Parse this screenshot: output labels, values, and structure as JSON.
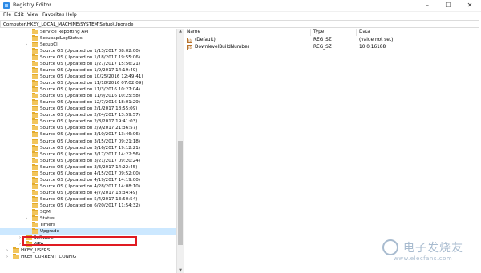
{
  "window": {
    "title": "Registry Editor"
  },
  "menu": [
    "File",
    "Edit",
    "View",
    "Favorites",
    "Help"
  ],
  "address": "Computer\\HKEY_LOCAL_MACHINE\\SYSTEM\\Setup\\Upgrade",
  "tree": [
    {
      "label": "Service Reporting API",
      "indent": 1
    },
    {
      "label": "SetupapiLogStatus",
      "indent": 1
    },
    {
      "label": "SetupCl",
      "indent": 1,
      "expander": "›"
    },
    {
      "label": "Source OS (Updated on 1/13/2017 08:02:00)",
      "indent": 1
    },
    {
      "label": "Source OS (Updated on 1/18/2017 19:55:06)",
      "indent": 1
    },
    {
      "label": "Source OS (Updated on 1/27/2017 15:56:21)",
      "indent": 1
    },
    {
      "label": "Source OS (Updated on 1/9/2017 14:19:49)",
      "indent": 1
    },
    {
      "label": "Source OS (Updated on 10/25/2016 12:49:41)",
      "indent": 1
    },
    {
      "label": "Source OS (Updated on 11/18/2016 07:02:09)",
      "indent": 1
    },
    {
      "label": "Source OS (Updated on 11/3/2016 10:27:04)",
      "indent": 1
    },
    {
      "label": "Source OS (Updated on 11/9/2016 10:25:58)",
      "indent": 1
    },
    {
      "label": "Source OS (Updated on 12/7/2016 18:01:29)",
      "indent": 1
    },
    {
      "label": "Source OS (Updated on 2/1/2017 18:55:09)",
      "indent": 1
    },
    {
      "label": "Source OS (Updated on 2/24/2017 13:59:57)",
      "indent": 1
    },
    {
      "label": "Source OS (Updated on 2/8/2017 19:41:03)",
      "indent": 1
    },
    {
      "label": "Source OS (Updated on 2/9/2017 21:36:57)",
      "indent": 1
    },
    {
      "label": "Source OS (Updated on 3/10/2017 13:46:06)",
      "indent": 1
    },
    {
      "label": "Source OS (Updated on 3/15/2017 09:21:18)",
      "indent": 1
    },
    {
      "label": "Source OS (Updated on 3/16/2017 19:12:21)",
      "indent": 1
    },
    {
      "label": "Source OS (Updated on 3/17/2017 14:22:56)",
      "indent": 1
    },
    {
      "label": "Source OS (Updated on 3/21/2017 09:20:24)",
      "indent": 1
    },
    {
      "label": "Source OS (Updated on 3/3/2017 14:22:45)",
      "indent": 1
    },
    {
      "label": "Source OS (Updated on 4/15/2017 09:52:00)",
      "indent": 1
    },
    {
      "label": "Source OS (Updated on 4/19/2017 14:19:00)",
      "indent": 1
    },
    {
      "label": "Source OS (Updated on 4/28/2017 14:08:10)",
      "indent": 1
    },
    {
      "label": "Source OS (Updated on 4/7/2017 18:34:49)",
      "indent": 1
    },
    {
      "label": "Source OS (Updated on 5/4/2017 13:50:54)",
      "indent": 1
    },
    {
      "label": "Source OS (Updated on 6/20/2017 11:54:32)",
      "indent": 1
    },
    {
      "label": "SQM",
      "indent": 1
    },
    {
      "label": "Status",
      "indent": 1,
      "expander": "›"
    },
    {
      "label": "Timers",
      "indent": 1
    },
    {
      "label": "Upgrade",
      "indent": 1,
      "selected": true
    },
    {
      "label": "Software",
      "indent": 0,
      "expander": "›"
    },
    {
      "label": "WPA",
      "indent": 0,
      "expander": "›"
    },
    {
      "label": "HKEY_USERS",
      "indent": -1,
      "expander": "›"
    },
    {
      "label": "HKEY_CURRENT_CONFIG",
      "indent": -1,
      "expander": "›"
    }
  ],
  "values_table": {
    "columns": [
      "Name",
      "Type",
      "Data"
    ],
    "rows": [
      {
        "name": "(Default)",
        "type": "REG_SZ",
        "data": "(value not set)"
      },
      {
        "name": "DownlevelBuildNumber",
        "type": "REG_SZ",
        "data": "10.0.16188"
      }
    ]
  },
  "watermark": {
    "cn": "电子发烧友",
    "url": "www.elecfans.com"
  },
  "colors": {
    "highlight": "#e01b22",
    "folder": "#f2c55c",
    "selection": "#cce8ff"
  }
}
